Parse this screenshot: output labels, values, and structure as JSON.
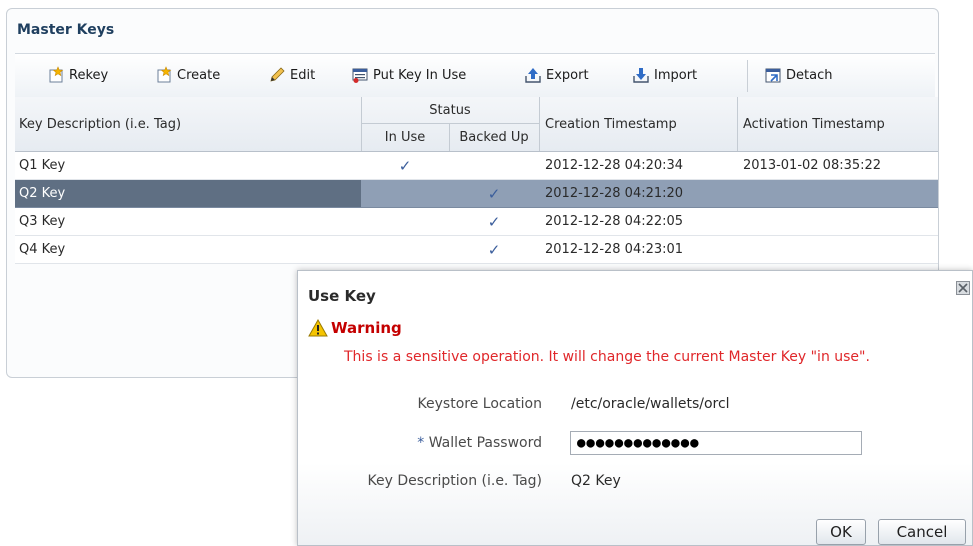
{
  "panel": {
    "title": "Master Keys",
    "toolbar": {
      "rekey": "Rekey",
      "create": "Create",
      "edit": "Edit",
      "put_in_use": "Put Key In Use",
      "export": "Export",
      "import": "Import",
      "detach": "Detach"
    },
    "columns": {
      "description": "Key Description (i.e. Tag)",
      "status": "Status",
      "in_use": "In Use",
      "backed_up": "Backed Up",
      "created": "Creation Timestamp",
      "activated": "Activation Timestamp"
    },
    "rows": [
      {
        "description": "Q1 Key",
        "in_use": "✓",
        "backed_up": "",
        "created": "2012-12-28 04:20:34",
        "activated": "2013-01-02 08:35:22"
      },
      {
        "description": "Q2 Key",
        "in_use": "",
        "backed_up": "✓",
        "created": "2012-12-28 04:21:20",
        "activated": ""
      },
      {
        "description": "Q3 Key",
        "in_use": "",
        "backed_up": "✓",
        "created": "2012-12-28 04:22:05",
        "activated": ""
      },
      {
        "description": "Q4 Key",
        "in_use": "",
        "backed_up": "✓",
        "created": "2012-12-28 04:23:01",
        "activated": ""
      }
    ],
    "selected_row": "Q2 Key"
  },
  "dialog": {
    "title": "Use Key",
    "warning_label": "Warning",
    "warning_message": "This is a sensitive operation. It will change the current Master Key \"in use\".",
    "keystore_label": "Keystore Location",
    "keystore_value": "/etc/oracle/wallets/orcl",
    "required_marker": "*",
    "password_label": "Wallet Password",
    "password_value": "●●●●●●●●●●●●●",
    "description_label": "Key Description (i.e. Tag)",
    "description_value": "Q2 Key",
    "ok_label": "OK",
    "cancel_label": "Cancel"
  },
  "icons": {
    "rekey": "rekey-icon",
    "create": "create-icon",
    "edit": "pencil-icon",
    "put_in_use": "put-key-in-use-icon",
    "export": "export-icon",
    "import": "import-icon",
    "detach": "detach-icon",
    "warning": "warning-icon",
    "close": "close-icon"
  },
  "colors": {
    "title": "#1f3f5f",
    "warning": "#e0272a",
    "check": "#3b5e9c",
    "selected_row": "#8f9fb5"
  }
}
